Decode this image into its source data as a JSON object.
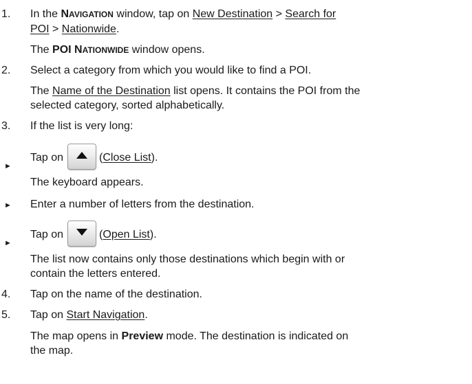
{
  "steps": [
    {
      "num": "1.",
      "parts": [
        "In the ",
        "N",
        "AVIGATION",
        " window, tap on ",
        "New Destination",
        " > ",
        "Search for",
        "POI",
        " > ",
        "Nationwide",
        "."
      ]
    },
    {
      "result": [
        "The ",
        "POI N",
        "ATIONWIDE",
        " window opens."
      ]
    },
    {
      "num": "2.",
      "text": "Select a category from which you would like to find a POI."
    },
    {
      "result_parts": [
        "The ",
        "Name of the Destination",
        " list opens. It contains the POI from the",
        "selected category, sorted alphabetically."
      ]
    },
    {
      "num": "3.",
      "text": "If the list is very long:"
    },
    {
      "num": "4.",
      "text": "Tap on the name of the destination."
    },
    {
      "num": "5.",
      "parts": [
        "Tap on ",
        "Start Navigation",
        "."
      ]
    },
    {
      "result_parts": [
        "The map opens in ",
        "Preview",
        " mode. The destination is indicated on",
        "the map."
      ]
    }
  ],
  "substeps": [
    {
      "bullet": "►",
      "before": "Tap on",
      "button": "arrow-up",
      "link": "Close List",
      "result": "The keyboard appears."
    },
    {
      "bullet": "►",
      "text": "Enter a number of letters from the destination."
    },
    {
      "bullet": "►",
      "before": "Tap on",
      "button": "arrow-down",
      "link": "Open List",
      "result_lines": [
        "The list now contains only those destinations which begin with or",
        "contain the letters entered."
      ]
    }
  ]
}
